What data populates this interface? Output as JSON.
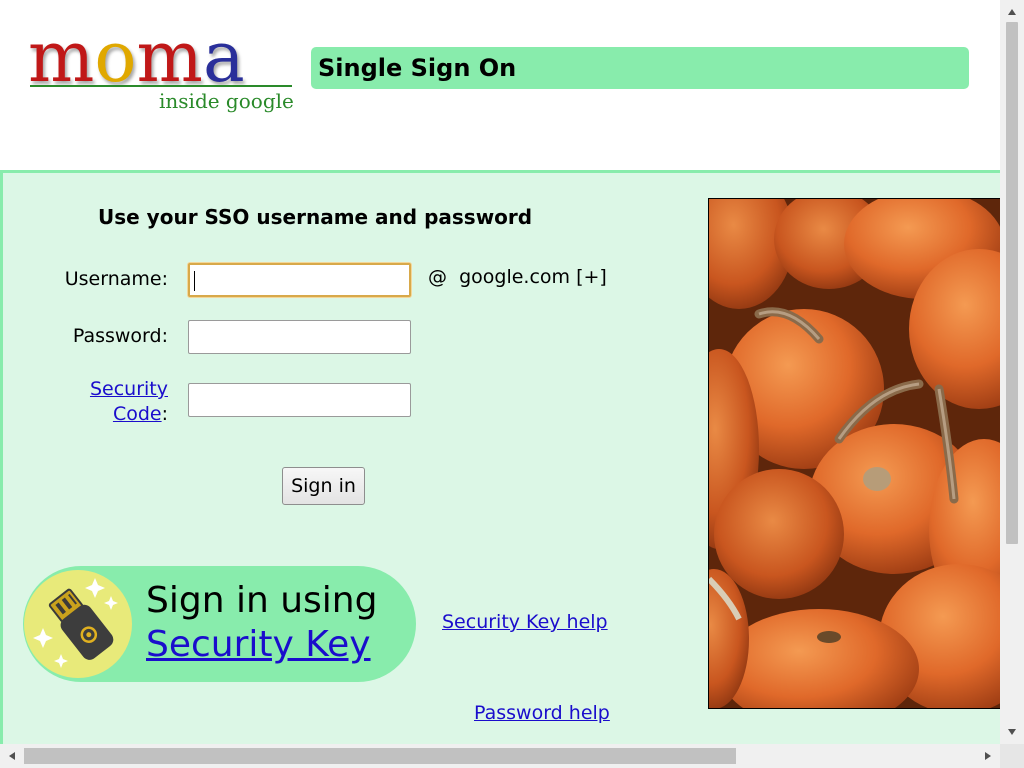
{
  "logo": {
    "letters": [
      "m",
      "o",
      "m",
      "a"
    ],
    "letter_colors": [
      "#c01818",
      "#e0a800",
      "#c01818",
      "#2a2f9a"
    ],
    "subtitle": "inside google"
  },
  "header": {
    "title": "Single Sign On",
    "accent": "#88ecac"
  },
  "form": {
    "heading": "Use your SSO username and password",
    "username_label": "Username:",
    "username_value": "",
    "domain_text": "@  google.com [+]",
    "password_label": "Password:",
    "security_link_line1": "Security",
    "security_link_line2": "Code",
    "security_colon": ":",
    "signin_label": "Sign in"
  },
  "security_key": {
    "line1": "Sign in using",
    "line2": "Security Key",
    "help": "Security Key help"
  },
  "password_help": "Password help",
  "photo": {
    "subject": "pumpkins"
  },
  "colors": {
    "panel_bg": "#dcf7e6",
    "link": "#1a0dcc"
  }
}
